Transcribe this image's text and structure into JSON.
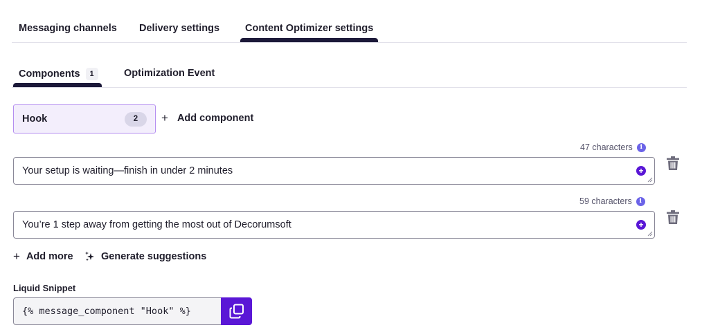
{
  "top_tabs": [
    {
      "label": "Messaging channels"
    },
    {
      "label": "Delivery settings"
    },
    {
      "label": "Content Optimizer settings",
      "active": true
    }
  ],
  "sub_tabs": [
    {
      "label": "Components",
      "count": "1",
      "active": true
    },
    {
      "label": "Optimization Event"
    }
  ],
  "component_chip": {
    "label": "Hook",
    "count": "2"
  },
  "add_component_label": "Add component",
  "variants": [
    {
      "char_count": "47 characters",
      "text": "Your setup is waiting—finish in under 2 minutes"
    },
    {
      "char_count": "59 characters",
      "text": "You’re 1 step away from getting the most out of Decorumsoft"
    }
  ],
  "actions": {
    "add_more": "Add more",
    "generate_suggestions": "Generate suggestions"
  },
  "snippet": {
    "label": "Liquid Snippet",
    "code": "{% message_component \"Hook\" %}"
  },
  "colors": {
    "accent": "#5a17d6",
    "chip_bg": "#f3eefc",
    "tab_underline": "#1c1939",
    "info": "#6b63e8"
  },
  "icons": [
    "plus-icon",
    "info-icon",
    "trash-icon",
    "sparkle-icon",
    "copy-icon"
  ]
}
